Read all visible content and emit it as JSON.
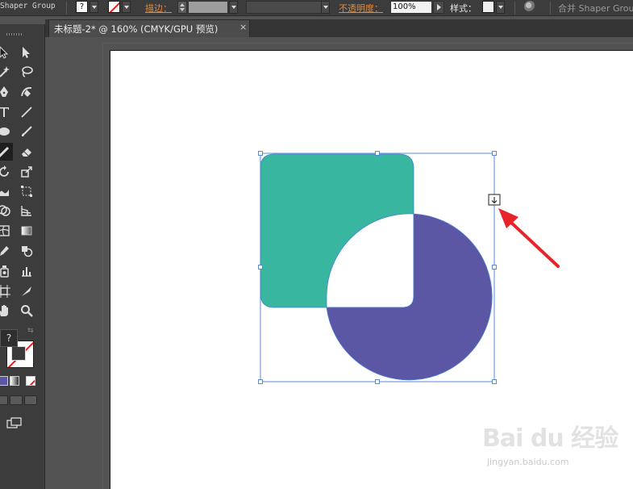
{
  "control_bar": {
    "shaper_group_label": "Shaper Group",
    "fill_indicator": "?",
    "stroke_label": "描边：",
    "opacity_label": "不透明度：",
    "opacity_value": "100%",
    "style_label": "样式：",
    "merge_shaper_group_label": "合并 Shaper Grou"
  },
  "document_tab": {
    "title": "未标题-2* @ 160% (CMYK/GPU 预览)",
    "close_glyph": "×"
  },
  "toolbar": {
    "fill_indicator": "?",
    "tools": [
      "selection-tool",
      "direct-selection-tool",
      "magic-wand-tool",
      "lasso-tool",
      "pen-tool",
      "curvature-tool",
      "type-tool",
      "line-segment-tool",
      "ellipse-tool",
      "paintbrush-tool",
      "shaper-tool",
      "eraser-tool",
      "rotate-tool",
      "scale-tool",
      "warp-tool",
      "free-transform-tool",
      "shape-builder-tool",
      "perspective-grid-tool",
      "mesh-tool",
      "gradient-tool",
      "eyedropper-tool",
      "blend-tool",
      "symbol-sprayer-tool",
      "column-graph-tool",
      "artboard-tool",
      "slice-tool",
      "hand-tool",
      "zoom-tool"
    ]
  },
  "canvas": {
    "shapes": [
      {
        "name": "rounded-square",
        "color": "#38b6a0"
      },
      {
        "name": "circle",
        "color": "#5b57a5"
      }
    ],
    "bounding_box_color": "#4a7fd4",
    "pointer_arrow_color": "#e8242a"
  },
  "watermark": {
    "brand": "Bai du 经验",
    "url": "jingyan.baidu.com"
  }
}
